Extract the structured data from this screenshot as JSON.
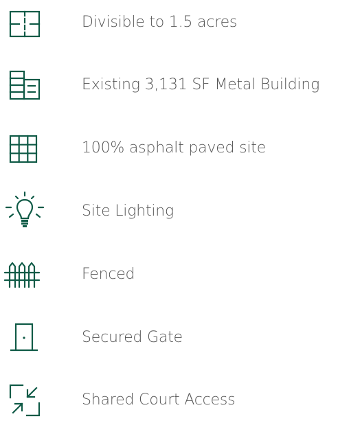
{
  "theme": {
    "icon_color": "#0f5a46",
    "text_color": "#555555"
  },
  "features": [
    {
      "label": "Divisible to 1.5 acres",
      "icon": "divided-lot-icon"
    },
    {
      "label": "Existing 3,131 SF Metal Building",
      "icon": "building-icon"
    },
    {
      "label": "100% asphalt paved site",
      "icon": "paving-grid-icon"
    },
    {
      "label": "Site Lighting",
      "icon": "light-bulb-icon"
    },
    {
      "label": "Fenced",
      "icon": "fence-icon"
    },
    {
      "label": "Secured Gate",
      "icon": "door-icon"
    },
    {
      "label": "Shared Court Access",
      "icon": "access-arrows-icon"
    }
  ]
}
